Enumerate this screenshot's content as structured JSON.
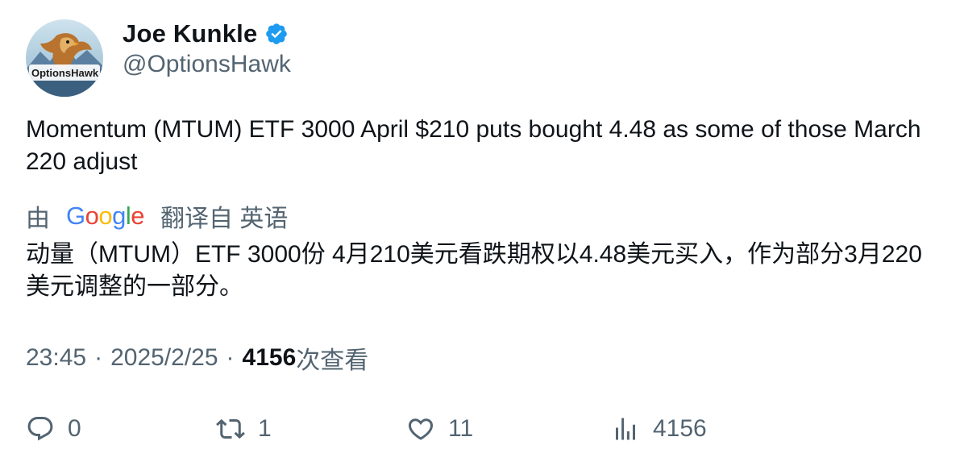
{
  "author": {
    "display_name": "Joe Kunkle",
    "handle": "@OptionsHawk",
    "verified": true,
    "avatar_icon": "hawk-avatar-icon",
    "avatar_text": "OptionsHawk"
  },
  "tweet": {
    "text": "Momentum (MTUM) ETF 3000 April $210 puts bought 4.48 as some of those March 220 adjust"
  },
  "translation": {
    "by_label": "由",
    "provider": "Google",
    "from_label": "翻译自 英语",
    "text": "动量（MTUM）ETF 3000份 4月210美元看跌期权以4.48美元买入，作为部分3月220美元调整的一部分。"
  },
  "meta": {
    "time": "23:45",
    "separator": "·",
    "date": "2025/2/25",
    "views_count": "4156",
    "views_label": "次查看"
  },
  "actions": {
    "replies": "0",
    "retweets": "1",
    "likes": "11",
    "views": "4156"
  },
  "colors": {
    "text_primary": "#0f1419",
    "text_secondary": "#536471",
    "verified_blue": "#1d9bf0"
  }
}
